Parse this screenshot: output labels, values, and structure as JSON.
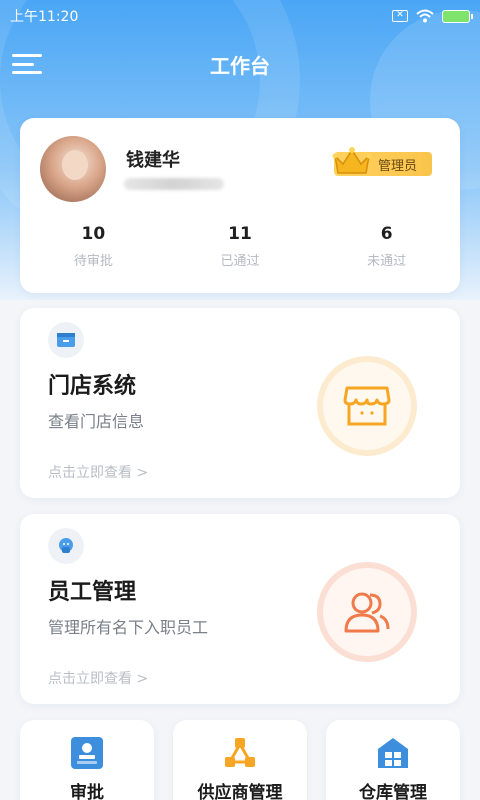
{
  "status_bar": {
    "time": "上午11:20"
  },
  "nav": {
    "title": "工作台"
  },
  "user": {
    "name": "钱建华",
    "role": "管理员",
    "stats": [
      {
        "value": "10",
        "label": "待审批"
      },
      {
        "value": "11",
        "label": "已通过"
      },
      {
        "value": "6",
        "label": "未通过"
      }
    ]
  },
  "features": [
    {
      "title": "门店系统",
      "desc": "查看门店信息",
      "link": "点击立即查看 >"
    },
    {
      "title": "员工管理",
      "desc": "管理所有名下入职员工",
      "link": "点击立即查看 >"
    }
  ],
  "quick_actions": [
    {
      "label": "审批",
      "icon": "approval-icon",
      "color": "#3d8fde"
    },
    {
      "label": "供应商管理",
      "icon": "supplier-icon",
      "color": "#f6a623"
    },
    {
      "label": "仓库管理",
      "icon": "warehouse-icon",
      "color": "#3d8fde"
    }
  ],
  "colors": {
    "primary": "#4aa6f5",
    "store_accent": "#f6a623",
    "staff_accent": "#f07a4a"
  }
}
